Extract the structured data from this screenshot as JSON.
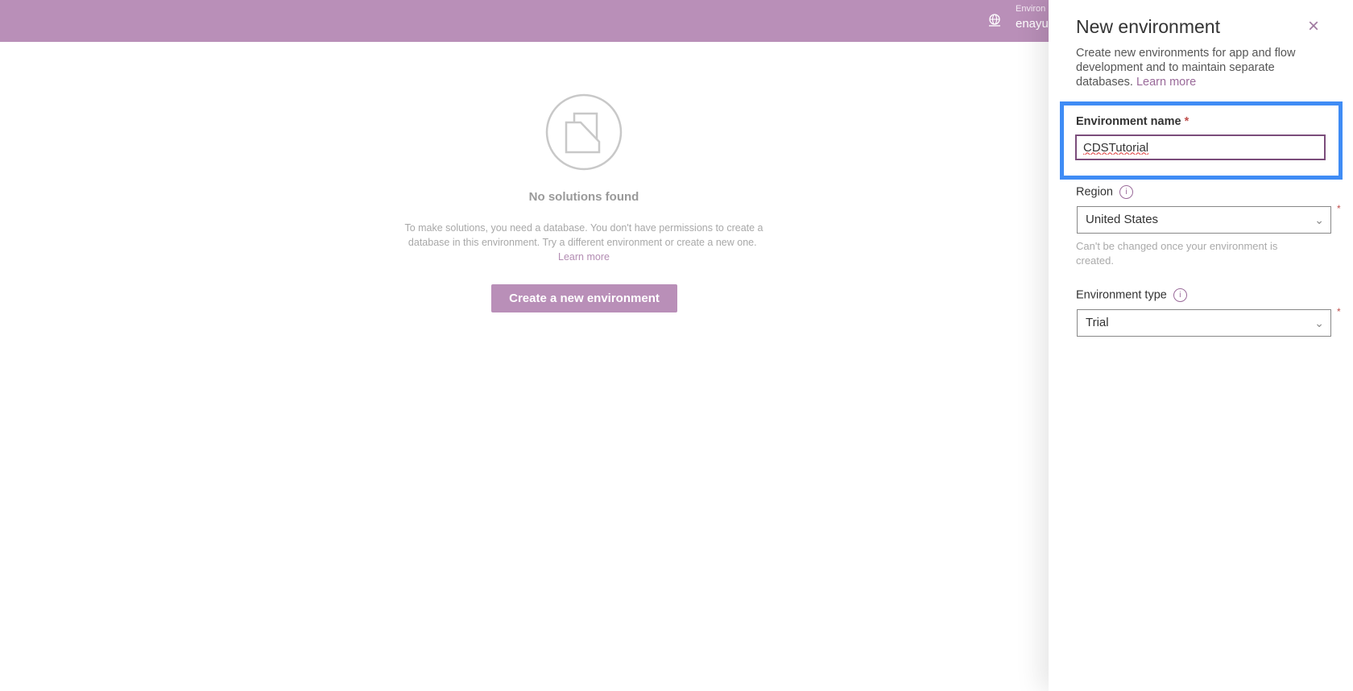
{
  "topbar": {
    "color": "#b98fb8",
    "environment_caption": "Environ",
    "environment_name": "enayu",
    "icon": "globe-icon"
  },
  "empty_state": {
    "icon": "solution-folder-icon",
    "title": "No solutions found",
    "text": "To make solutions, you need a database. You don't have permissions to create a database in this environment. Try a different environment or create a new one.",
    "learn_more": "Learn more",
    "button": "Create a new environment"
  },
  "panel": {
    "title": "New environment",
    "close_icon": "close-icon",
    "description": "Create new environments for app and flow development and to maintain separate databases.",
    "learn_more": "Learn more",
    "name_label": "Environment name",
    "required_mark": "*",
    "name_value": "CDSTutorial",
    "region_label": "Region",
    "region_value": "United States",
    "region_help": "Can't be changed once your environment is created.",
    "type_label": "Environment type",
    "type_value": "Trial",
    "highlight_color": "#3f8cf5"
  }
}
